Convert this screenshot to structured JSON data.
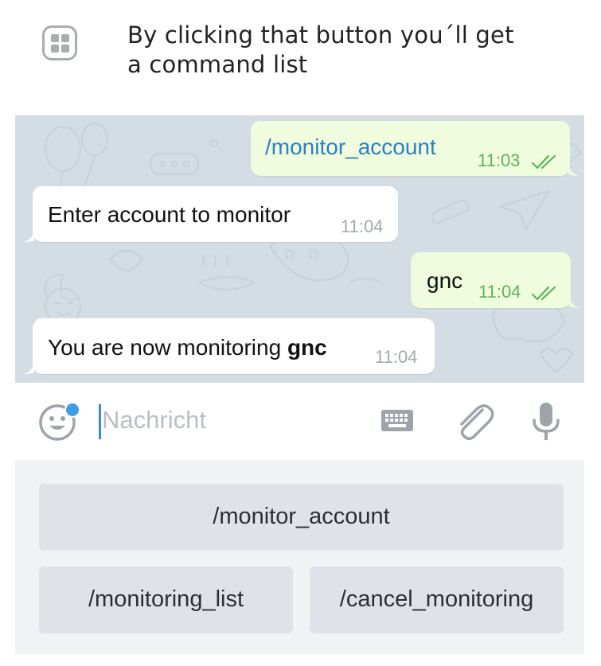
{
  "caption": {
    "icon": "bot-command-icon",
    "line1": "By clicking that button you´ll get",
    "line2": "a command list"
  },
  "messages": [
    {
      "direction": "out",
      "text": "/monitor_account",
      "is_command": true,
      "time": "11:03",
      "status": "read"
    },
    {
      "direction": "in",
      "text": "Enter account to monitor",
      "time": "11:04"
    },
    {
      "direction": "out",
      "text": "gnc",
      "time": "11:04",
      "status": "read"
    },
    {
      "direction": "in",
      "text_prefix": "You are now monitoring ",
      "text_bold": "gnc",
      "time": "11:04"
    }
  ],
  "input": {
    "placeholder": "Nachricht",
    "emoji_icon": "smiley-icon",
    "keyboard_icon": "keyboard-icon",
    "attach_icon": "paperclip-icon",
    "mic_icon": "microphone-icon"
  },
  "keyboard": {
    "rows": [
      [
        "/monitor_account"
      ],
      [
        "/monitoring_list",
        "/cancel_monitoring"
      ]
    ]
  },
  "colors": {
    "outgoing_bubble": "#effdde",
    "incoming_bubble": "#ffffff",
    "chat_background": "#d4dde4",
    "command_link": "#2f7fbf",
    "read_ticks": "#5fb459",
    "keyboard_button": "#dfe3e7",
    "caret": "#3b8bd0"
  }
}
